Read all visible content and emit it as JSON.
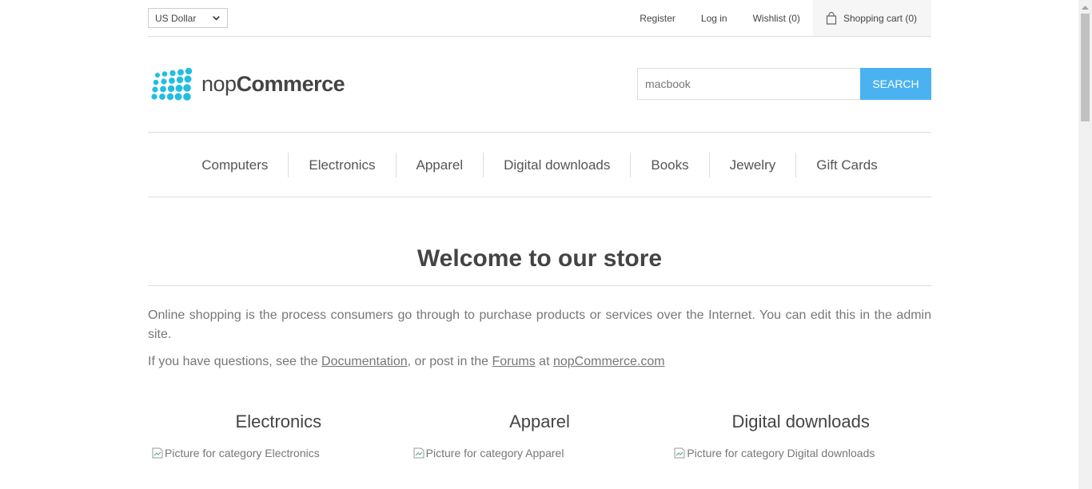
{
  "header": {
    "currency": "US Dollar",
    "links": {
      "register": "Register",
      "login": "Log in",
      "wishlist": "Wishlist (0)",
      "cart": "Shopping cart (0)"
    }
  },
  "logo": {
    "prefix": "nop",
    "suffix": "Commerce",
    "color": "#23bde2"
  },
  "search": {
    "value": "macbook",
    "button": "Search",
    "button_color": "#4ab2f1"
  },
  "menu": [
    "Computers",
    "Electronics",
    "Apparel",
    "Digital downloads",
    "Books",
    "Jewelry",
    "Gift Cards"
  ],
  "content": {
    "title": "Welcome to our store",
    "paragraph1": "Online shopping is the process consumers go through to purchase products or services over the Internet. You can edit this in the admin site.",
    "paragraph2": {
      "pre": "If you have questions, see the ",
      "doc_link": "Documentation",
      "mid": ", or post in the ",
      "forums_link": "Forums",
      "at": " at ",
      "site_link": "nopCommerce.com"
    }
  },
  "categories": [
    {
      "title": "Electronics",
      "image_alt": "Picture for category Electronics"
    },
    {
      "title": "Apparel",
      "image_alt": "Picture for category Apparel"
    },
    {
      "title": "Digital downloads",
      "image_alt": "Picture for category Digital downloads"
    }
  ]
}
